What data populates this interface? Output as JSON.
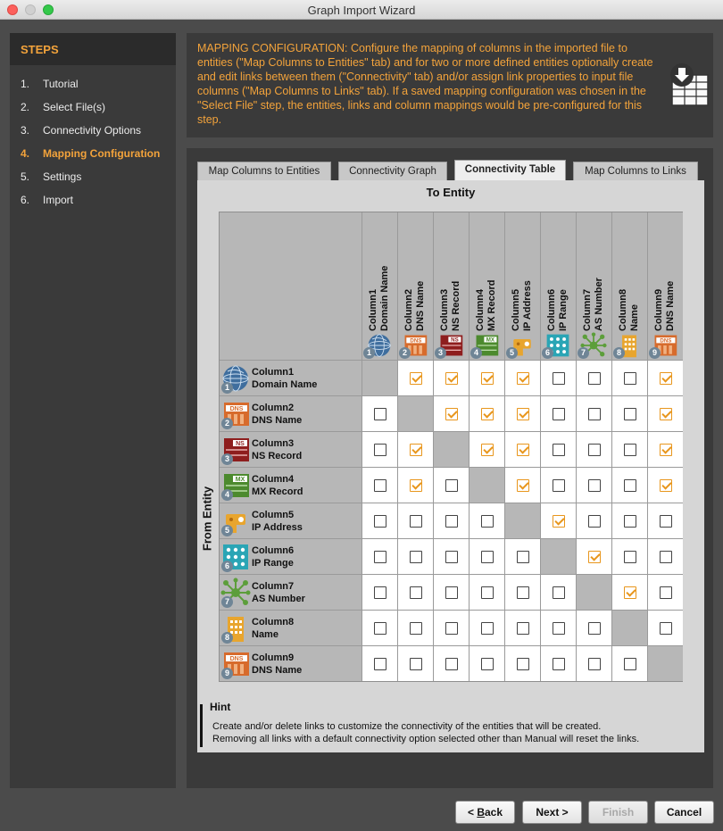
{
  "window": {
    "title": "Graph Import Wizard"
  },
  "sidebar": {
    "header": "STEPS",
    "steps": [
      {
        "num": "1.",
        "label": "Tutorial",
        "active": false
      },
      {
        "num": "2.",
        "label": "Select File(s)",
        "active": false
      },
      {
        "num": "3.",
        "label": "Connectivity Options",
        "active": false
      },
      {
        "num": "4.",
        "label": "Mapping Configuration",
        "active": true
      },
      {
        "num": "5.",
        "label": "Settings",
        "active": false
      },
      {
        "num": "6.",
        "label": "Import",
        "active": false
      }
    ]
  },
  "description": {
    "text": "MAPPING CONFIGURATION: Configure the mapping of columns in the imported file to entities (\"Map Columns to Entities\" tab) and for two or more defined entities optionally create and edit links between them (\"Connectivity\" tab) and/or assign link properties to input file columns (\"Map Columns to Links\" tab). If a saved mapping configuration was chosen in the \"Select File\" step, the entities, links and column mappings would be pre-configured for this step.",
    "icon": "import-table-icon"
  },
  "tabs": [
    {
      "label": "Map Columns to Entities",
      "active": false
    },
    {
      "label": "Connectivity Graph",
      "active": false
    },
    {
      "label": "Connectivity Table",
      "active": true
    },
    {
      "label": "Map Columns to Links",
      "active": false
    }
  ],
  "matrix": {
    "to_label": "To Entity",
    "from_label": "From Entity",
    "entities": [
      {
        "num": "1",
        "column": "Column1",
        "type": "Domain Name",
        "icon": "globe-icon"
      },
      {
        "num": "2",
        "column": "Column2",
        "type": "DNS Name",
        "icon": "dns-icon"
      },
      {
        "num": "3",
        "column": "Column3",
        "type": "NS Record",
        "icon": "ns-record-icon"
      },
      {
        "num": "4",
        "column": "Column4",
        "type": "MX Record",
        "icon": "mx-record-icon"
      },
      {
        "num": "5",
        "column": "Column5",
        "type": "IP Address",
        "icon": "ip-address-icon"
      },
      {
        "num": "6",
        "column": "Column6",
        "type": "IP Range",
        "icon": "ip-range-icon"
      },
      {
        "num": "7",
        "column": "Column7",
        "type": "AS Number",
        "icon": "as-number-icon"
      },
      {
        "num": "8",
        "column": "Column8",
        "type": "Name",
        "icon": "building-icon"
      },
      {
        "num": "9",
        "column": "Column9",
        "type": "DNS Name",
        "icon": "dns-icon"
      }
    ],
    "links": [
      [
        null,
        1,
        1,
        1,
        1,
        0,
        0,
        0,
        1
      ],
      [
        0,
        null,
        1,
        1,
        1,
        0,
        0,
        0,
        1
      ],
      [
        0,
        1,
        null,
        1,
        1,
        0,
        0,
        0,
        1
      ],
      [
        0,
        1,
        0,
        null,
        1,
        0,
        0,
        0,
        1
      ],
      [
        0,
        0,
        0,
        0,
        null,
        1,
        0,
        0,
        0
      ],
      [
        0,
        0,
        0,
        0,
        0,
        null,
        1,
        0,
        0
      ],
      [
        0,
        0,
        0,
        0,
        0,
        0,
        null,
        1,
        0
      ],
      [
        0,
        0,
        0,
        0,
        0,
        0,
        0,
        null,
        0
      ],
      [
        0,
        0,
        0,
        0,
        0,
        0,
        0,
        0,
        null
      ]
    ]
  },
  "hint": {
    "title": "Hint",
    "lines": [
      "Create and/or delete links to customize the connectivity of the entities that will be created.",
      "Removing all links with a default connectivity option selected other than Manual will reset the links."
    ]
  },
  "buttons": {
    "back_prefix": "< ",
    "back_mnemonic": "B",
    "back_rest": "ack",
    "next": "Next >",
    "finish": "Finish",
    "cancel": "Cancel"
  },
  "colors": {
    "accent": "#f3a33b",
    "check": "#e8961c",
    "panel": "#3a3a3a",
    "background": "#4b4b4b"
  }
}
